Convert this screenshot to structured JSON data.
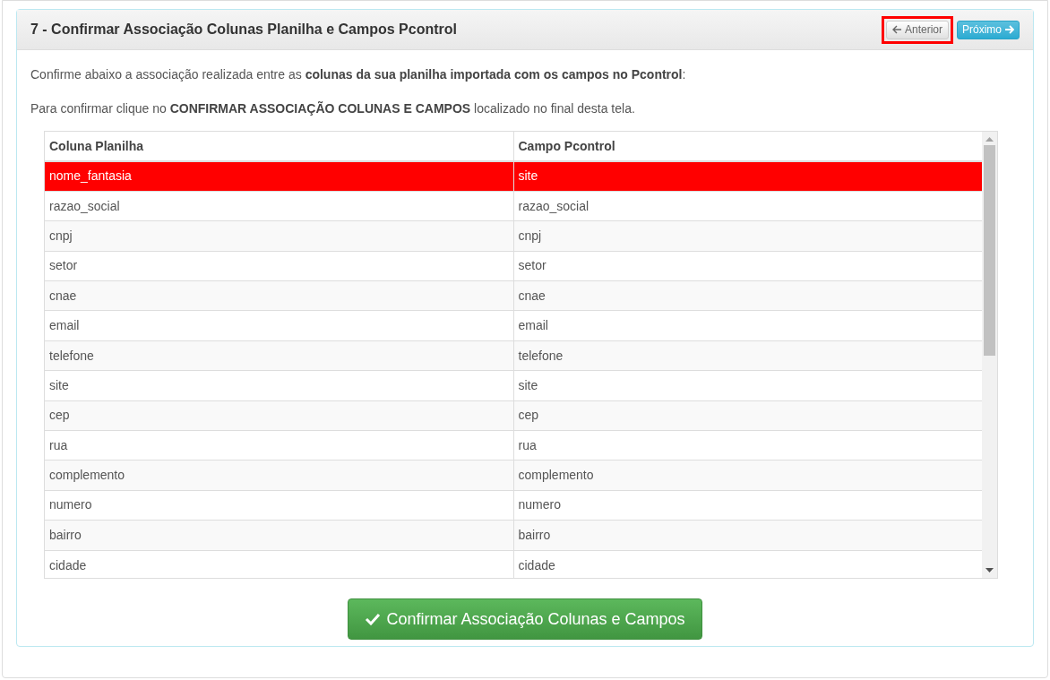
{
  "panel": {
    "title": "7 - Confirmar Associação Colunas Planilha e Campos Pcontrol",
    "nav_buttons": [
      {
        "kind": "prev",
        "label": "Anterior",
        "highlighted": true
      },
      {
        "kind": "next",
        "label": "Próximo",
        "highlighted": false
      }
    ]
  },
  "instructions": [
    "Confirme abaixo a associação realizada entre as **colunas da sua planilha importada com os campos no Pcontrol**:",
    "Para confirmar clique no **CONFIRMAR ASSOCIAÇÃO COLUNAS E CAMPOS** localizado no final desta tela."
  ],
  "table": {
    "columns": [
      "Coluna Planilha",
      "Campo Pcontrol"
    ],
    "rows": [
      {
        "cells": [
          "nome_fantasia",
          "site"
        ],
        "selected": true
      },
      {
        "cells": [
          "razao_social",
          "razao_social"
        ],
        "selected": false
      },
      {
        "cells": [
          "cnpj",
          "cnpj"
        ],
        "selected": false
      },
      {
        "cells": [
          "setor",
          "setor"
        ],
        "selected": false
      },
      {
        "cells": [
          "cnae",
          "cnae"
        ],
        "selected": false
      },
      {
        "cells": [
          "email",
          "email"
        ],
        "selected": false
      },
      {
        "cells": [
          "telefone",
          "telefone"
        ],
        "selected": false
      },
      {
        "cells": [
          "site",
          "site"
        ],
        "selected": false
      },
      {
        "cells": [
          "cep",
          "cep"
        ],
        "selected": false
      },
      {
        "cells": [
          "rua",
          "rua"
        ],
        "selected": false
      },
      {
        "cells": [
          "complemento",
          "complemento"
        ],
        "selected": false
      },
      {
        "cells": [
          "numero",
          "numero"
        ],
        "selected": false
      },
      {
        "cells": [
          "bairro",
          "bairro"
        ],
        "selected": false
      },
      {
        "cells": [
          "cidade",
          "cidade"
        ],
        "selected": false
      }
    ]
  },
  "confirm_button": {
    "label": "Confirmar Associação Colunas e Campos"
  }
}
